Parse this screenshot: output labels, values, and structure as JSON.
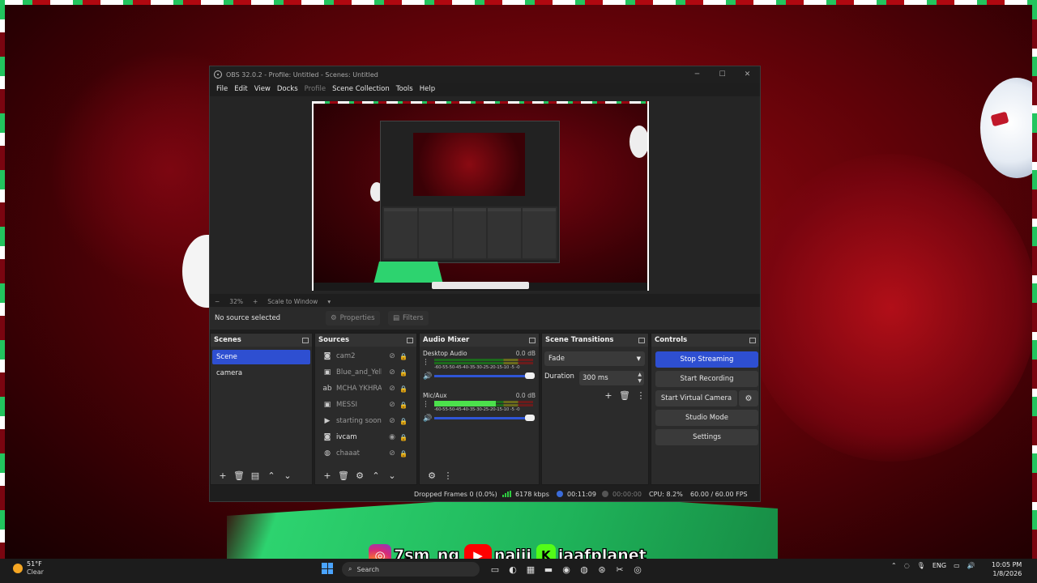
{
  "window": {
    "title": "OBS 32.0.2 - Profile: Untitled - Scenes: Untitled",
    "controls": [
      "─",
      "☐",
      "✕"
    ]
  },
  "menu": [
    "File",
    "Edit",
    "View",
    "Docks",
    "Profile",
    "Scene Collection",
    "Tools",
    "Help"
  ],
  "preview": {
    "zoom_minus": "−",
    "zoom": "32%",
    "zoom_plus": "+",
    "scale_mode": "Scale to Window",
    "scale_caret": "▾"
  },
  "source_bar": {
    "selection": "No source selected",
    "properties_label": "Properties",
    "filters_label": "Filters"
  },
  "docks": {
    "scenes": {
      "title": "Scenes",
      "items": [
        "Scene",
        "camera"
      ],
      "active_index": 0
    },
    "sources": {
      "title": "Sources",
      "items": [
        {
          "name": "cam2",
          "icon": "camera-icon",
          "glyph": "◙",
          "visible": false
        },
        {
          "name": "Blue_and_Yello",
          "icon": "image-icon",
          "glyph": "▣",
          "visible": false
        },
        {
          "name": "MCHA YKHRA",
          "icon": "text-icon",
          "glyph": "ab",
          "visible": false
        },
        {
          "name": "MESSI",
          "icon": "image-icon",
          "glyph": "▣",
          "visible": false
        },
        {
          "name": "starting soon",
          "icon": "play-icon",
          "glyph": "▶",
          "visible": false
        },
        {
          "name": "ivcam",
          "icon": "camera-icon",
          "glyph": "◙",
          "visible": true
        },
        {
          "name": "chaaat",
          "icon": "browser-icon",
          "glyph": "◍",
          "visible": false
        }
      ]
    },
    "mixer": {
      "title": "Audio Mixer",
      "channels": [
        {
          "name": "Desktop Audio",
          "db": "0.0 dB",
          "level": 0.0
        },
        {
          "name": "Mic/Aux",
          "db": "0.0 dB",
          "level": 0.62
        }
      ],
      "ticks": "-60-55-50-45-40-35-30-25-20-15-10 -5 -0"
    },
    "transitions": {
      "title": "Scene Transitions",
      "selected": "Fade",
      "duration_label": "Duration",
      "duration_value": "300 ms"
    },
    "controls": {
      "title": "Controls",
      "stop_streaming": "Stop Streaming",
      "start_recording": "Start Recording",
      "start_virtual_camera": "Start Virtual Camera",
      "studio_mode": "Studio Mode",
      "settings": "Settings"
    }
  },
  "status": {
    "dropped_frames": "Dropped Frames 0 (0.0%)",
    "bitrate": "6178 kbps",
    "stream_time": "00:11:09",
    "record_time": "00:00:00",
    "cpu": "CPU: 8.2%",
    "fps": "60.00 / 60.00 FPS"
  },
  "overlay": {
    "instagram": "7sm_ng",
    "youtube": "najij",
    "kick": "jaafplanet"
  },
  "taskbar": {
    "weather_temp": "51°F",
    "weather_desc": "Clear",
    "search_placeholder": "Search",
    "language": "ENG",
    "time": "10:05 PM",
    "date": "1/8/2026"
  },
  "colors": {
    "accent": "#2e4fd1",
    "window_bg": "#1e1e1e",
    "dock_bg": "#2b2b2b",
    "meter_green": "#4ce04c"
  }
}
